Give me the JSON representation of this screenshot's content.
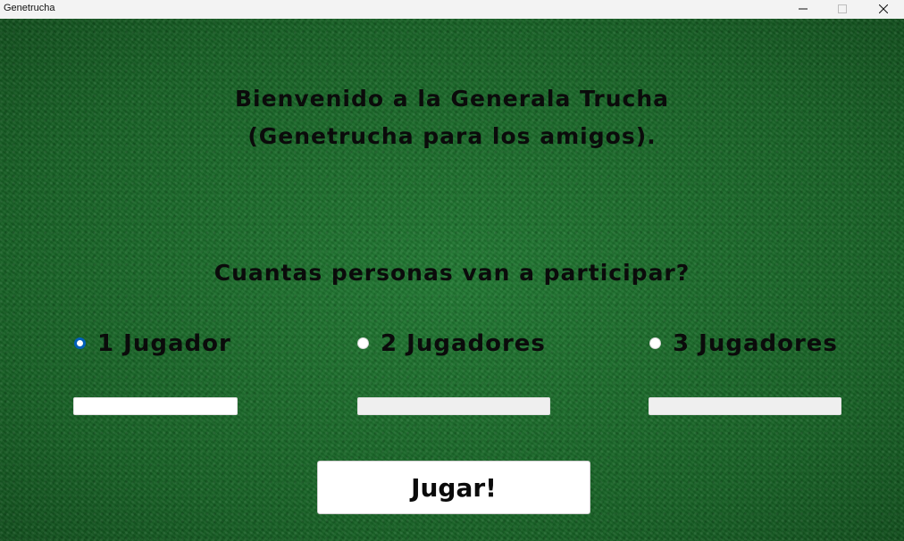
{
  "window": {
    "title": "Genetrucha",
    "controls": {
      "minimize": "minimize-icon",
      "maximize": "maximize-icon",
      "close": "close-icon"
    }
  },
  "welcome": {
    "line1": "Bienvenido a la Generala Trucha",
    "line2": "(Genetrucha para los amigos)."
  },
  "question": "Cuantas personas van a participar?",
  "player_options": [
    {
      "label": "1 Jugador",
      "selected": true
    },
    {
      "label": "2 Jugadores",
      "selected": false
    },
    {
      "label": "3 Jugadores",
      "selected": false
    }
  ],
  "name_fields": [
    {
      "value": "",
      "enabled": true
    },
    {
      "value": "",
      "enabled": false
    },
    {
      "value": "",
      "enabled": false
    }
  ],
  "play_button": {
    "label": "Jugar!"
  },
  "colors": {
    "background": "#1b6a2b",
    "radio_selected": "#005fb8",
    "text": "#0b0b0b"
  }
}
